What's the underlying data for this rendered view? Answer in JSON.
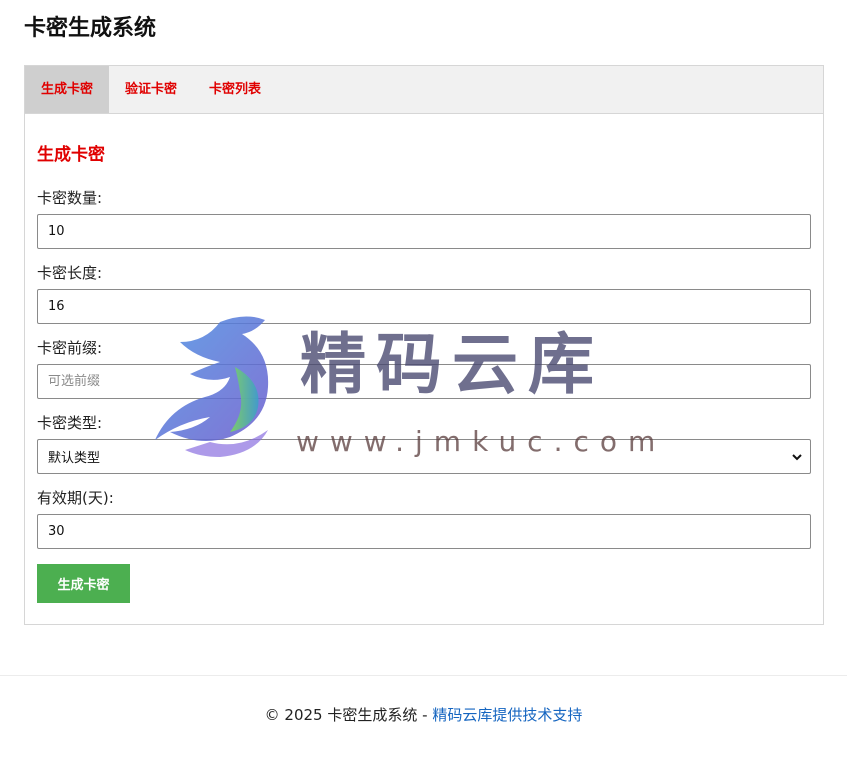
{
  "header": {
    "title": "卡密生成系统"
  },
  "tabs": [
    {
      "label": "生成卡密",
      "active": true
    },
    {
      "label": "验证卡密",
      "active": false
    },
    {
      "label": "卡密列表",
      "active": false
    }
  ],
  "form": {
    "title": "生成卡密",
    "count": {
      "label": "卡密数量:",
      "value": "10"
    },
    "length": {
      "label": "卡密长度:",
      "value": "16"
    },
    "prefix": {
      "label": "卡密前缀:",
      "value": "",
      "placeholder": "可选前缀"
    },
    "type": {
      "label": "卡密类型:",
      "selected": "默认类型"
    },
    "validity": {
      "label": "有效期(天):",
      "value": "30"
    },
    "submit_label": "生成卡密"
  },
  "footer": {
    "copyright": "© 2025 卡密生成系统 - ",
    "link_text": "精码云库提供技术支持"
  },
  "watermark": {
    "text": "精码云库",
    "url": "www.jmkuc.com"
  },
  "colors": {
    "accent_red": "#e00000",
    "button_green": "#4caf50",
    "link_blue": "#1565c0"
  }
}
